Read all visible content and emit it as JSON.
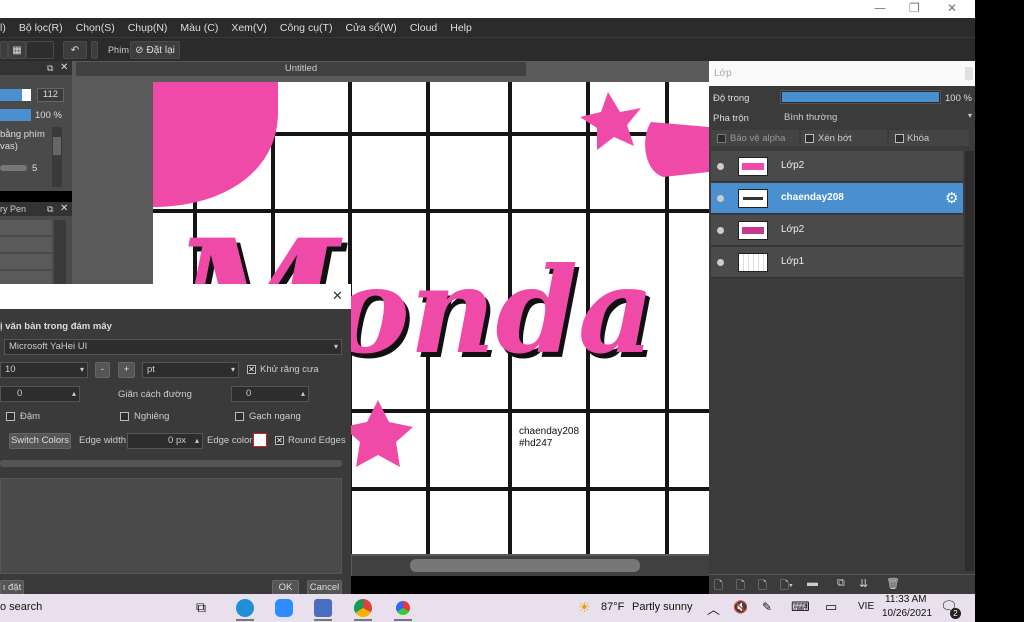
{
  "menu": [
    "l)",
    "Bộ lọc(R)",
    "Chọn(S)",
    "Chụp(N)",
    "Màu (C)",
    "Xem(V)",
    "Công cụ(T)",
    "Cửa sổ(W)",
    "Cloud",
    "Help"
  ],
  "toolbar": {
    "phim_label": "Phím",
    "reset_label": "Đặt lại"
  },
  "left_panel": {
    "size_value": "112",
    "opacity_value": "100 %",
    "text1": "bằng phím",
    "text2": "vas)",
    "num": "5",
    "brush_name": "ry Pen"
  },
  "document": {
    "tab_title": "Untitled"
  },
  "canvas": {
    "artwork_text": "onda",
    "signature_line1": "chaenday208",
    "signature_line2": "#hd247",
    "colors": {
      "pink": "#f04aa8",
      "grid": "#151515"
    }
  },
  "text_dialog": {
    "section_title": "ị văn bản trong đám mây",
    "font": "Microsoft YaHei UI",
    "font_size": "10",
    "minus": "-",
    "plus": "+",
    "unit": "pt",
    "antialias_label": "Khử răng cưa",
    "spacing_value": "0",
    "line_spacing_label": "Giãn cách đường",
    "line_spacing_value": "0",
    "bold_label": "Đậm",
    "italic_label": "Nghiêng",
    "strike_label": "Gạch ngang",
    "switch_colors": "Switch Colors",
    "edge_width_label": "Edge width",
    "edge_width_value": "0 px",
    "edge_color_label": "Edge color",
    "round_edges_label": "Round Edges",
    "reset_btn": "ı đặt",
    "ok_btn": "OK",
    "cancel_btn": "Cancel"
  },
  "layers": {
    "title": "Lớp",
    "opacity_label": "Độ trong",
    "opacity_value": "100 %",
    "opacity_fraction": 1.0,
    "blend_label": "Pha trộn",
    "blend_value": "Bình thường",
    "protect_alpha": "Bảo vệ alpha",
    "clip": "Xén bớt",
    "lock": "Khóa",
    "items": [
      {
        "name": "Lớp2",
        "selected": false
      },
      {
        "name": "chaenday208",
        "selected": true
      },
      {
        "name": "Lớp2",
        "selected": false
      },
      {
        "name": "Lớp1",
        "selected": false
      }
    ]
  },
  "taskbar": {
    "search": "o search",
    "weather_temp": "87°F",
    "weather_text": "Partly sunny",
    "lang": "VIE",
    "time": "11:33 AM",
    "date": "10/26/2021",
    "notif_count": "2"
  }
}
